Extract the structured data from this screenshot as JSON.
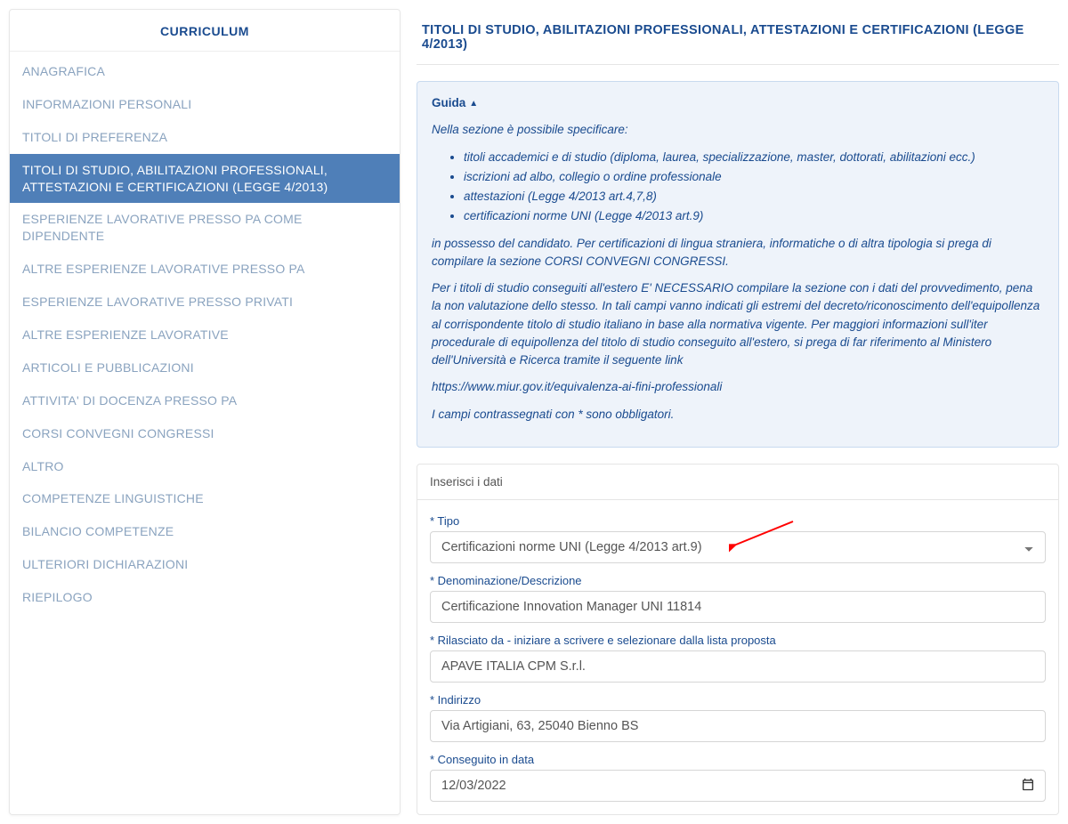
{
  "sidebar": {
    "title": "CURRICULUM",
    "items": [
      "ANAGRAFICA",
      "INFORMAZIONI PERSONALI",
      "TITOLI DI PREFERENZA",
      "TITOLI DI STUDIO, ABILITAZIONI PROFESSIONALI, ATTESTAZIONI E CERTIFICAZIONI (LEGGE 4/2013)",
      "ESPERIENZE LAVORATIVE PRESSO PA COME DIPENDENTE",
      "ALTRE ESPERIENZE LAVORATIVE PRESSO PA",
      "ESPERIENZE LAVORATIVE PRESSO PRIVATI",
      "ALTRE ESPERIENZE LAVORATIVE",
      "ARTICOLI E PUBBLICAZIONI",
      "ATTIVITA' DI DOCENZA PRESSO PA",
      "CORSI CONVEGNI CONGRESSI",
      "ALTRO",
      "COMPETENZE LINGUISTICHE",
      "BILANCIO COMPETENZE",
      "ULTERIORI DICHIARAZIONI",
      "RIEPILOGO"
    ],
    "active_index": 3
  },
  "main": {
    "title": "TITOLI DI STUDIO, ABILITAZIONI PROFESSIONALI, ATTESTAZIONI E CERTIFICAZIONI (LEGGE 4/2013)"
  },
  "guide": {
    "heading": "Guida",
    "intro": "Nella sezione è possibile specificare:",
    "bullets": [
      "titoli accademici e di studio (diploma, laurea, specializzazione, master, dottorati, abilitazioni ecc.)",
      "iscrizioni ad albo, collegio o ordine professionale",
      "attestazioni (Legge 4/2013 art.4,7,8)",
      "certificazioni norme UNI (Legge 4/2013 art.9)"
    ],
    "p1": "in possesso del candidato. Per certificazioni di lingua straniera, informatiche o di altra tipologia si prega di compilare la sezione CORSI CONVEGNI CONGRESSI.",
    "p2": "Per i titoli di studio conseguiti all'estero E' NECESSARIO compilare la sezione con i dati del provvedimento, pena la non valutazione dello stesso. In tali campi vanno indicati gli estremi del decreto/riconoscimento dell'equipollenza al corrispondente titolo di studio italiano in base alla normativa vigente. Per maggiori informazioni sull'iter procedurale di equipollenza del titolo di studio conseguito all'estero, si prega di far riferimento al Ministero dell'Università e Ricerca tramite il seguente link",
    "link": "https://www.miur.gov.it/equivalenza-ai-fini-professionali",
    "p3": "I campi contrassegnati con * sono obbligatori."
  },
  "form": {
    "header": "Inserisci i dati",
    "tipo_label": "* Tipo",
    "tipo_value": "Certificazioni norme UNI (Legge 4/2013 art.9)",
    "denominazione_label": "* Denominazione/Descrizione",
    "denominazione_value": "Certificazione Innovation Manager UNI 11814",
    "rilasciato_label": "* Rilasciato da - iniziare a scrivere e selezionare dalla lista proposta",
    "rilasciato_value": "APAVE ITALIA CPM S.r.l.",
    "indirizzo_label": "* Indirizzo",
    "indirizzo_value": "Via Artigiani, 63, 25040 Bienno BS",
    "conseguito_label": "* Conseguito in data",
    "conseguito_value": "12/03/2022"
  }
}
